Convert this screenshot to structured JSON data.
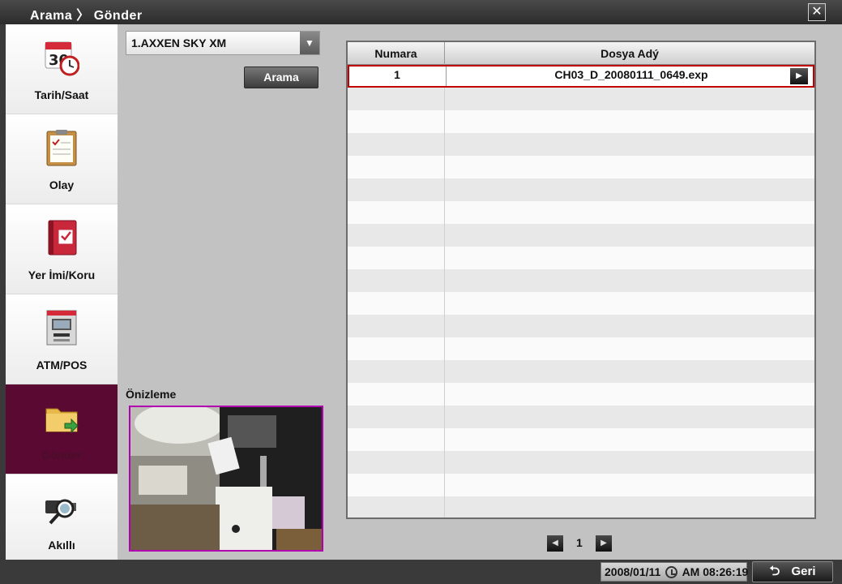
{
  "window": {
    "title": "Arama 〉 Gönder",
    "close_icon": "close-icon"
  },
  "sidebar": {
    "items": [
      {
        "label": "Tarih/Saat",
        "icon": "calendar-clock-icon",
        "active": false
      },
      {
        "label": "Olay",
        "icon": "clipboard-icon",
        "active": false
      },
      {
        "label": "Yer İmi/Koru",
        "icon": "bookmark-book-icon",
        "active": false
      },
      {
        "label": "ATM/POS",
        "icon": "atm-icon",
        "active": false
      },
      {
        "label": "Gönder",
        "icon": "folder-send-icon",
        "active": true
      },
      {
        "label": "Akıllı",
        "icon": "smart-camera-icon",
        "active": false
      }
    ]
  },
  "filter": {
    "device_selected": "1.AXXEN SKY XM",
    "search_label": "Arama"
  },
  "preview": {
    "label": "Önizleme"
  },
  "table": {
    "headers": [
      "Numara",
      "Dosya Adý"
    ],
    "rows": [
      {
        "number": "1",
        "file_name": "CH03_D_20080111_0649.exp",
        "selected": true
      }
    ],
    "empty_rows": 19
  },
  "pager": {
    "page": "1"
  },
  "status": {
    "datetime_date": "2008/01/11",
    "datetime_time": "AM 08:26:19",
    "back_label": "Geri"
  },
  "colors": {
    "active_sidebar": "#5a0a32",
    "selected_row_border": "#c00000",
    "preview_border": "#b000b0"
  }
}
